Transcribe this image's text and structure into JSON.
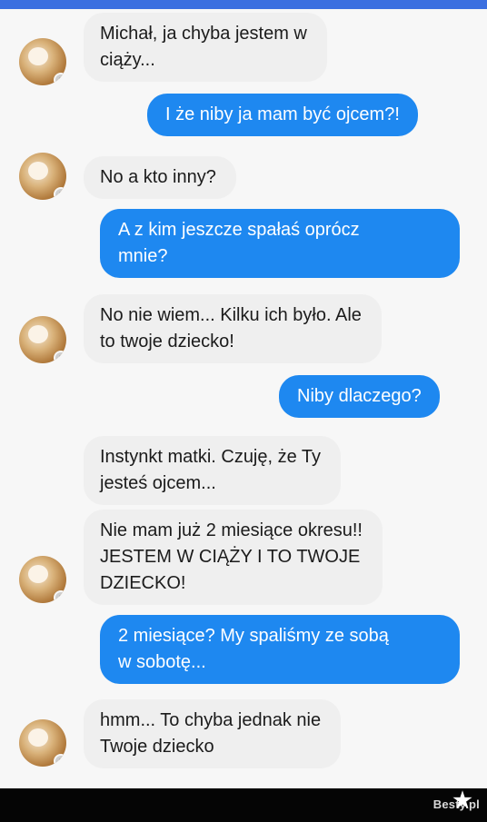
{
  "conversation": {
    "messages": [
      {
        "side": "incoming",
        "lines": [
          "Michał, ja chyba jestem w",
          "ciąży..."
        ]
      },
      {
        "side": "outgoing",
        "lines": [
          "I że niby ja mam być ojcem?!"
        ]
      },
      {
        "side": "incoming",
        "lines": [
          "No a kto inny?"
        ]
      },
      {
        "side": "outgoing",
        "lines": [
          "A z kim jeszcze spałaś oprócz",
          "mnie?"
        ]
      },
      {
        "side": "incoming",
        "lines": [
          "No nie wiem... Kilku ich było. Ale",
          "to twoje dziecko!"
        ]
      },
      {
        "side": "outgoing",
        "lines": [
          "Niby dlaczego?"
        ]
      },
      {
        "side": "incoming",
        "lines": [
          "Instynkt matki. Czuję, że Ty",
          "jesteś ojcem..."
        ]
      },
      {
        "side": "incoming",
        "lines": [
          "Nie mam już 2 miesiące okresu!!",
          "JESTEM W CIĄŻY I TO TWOJE",
          "DZIECKO!"
        ]
      },
      {
        "side": "outgoing",
        "lines": [
          "2 miesiące? My spaliśmy ze sobą",
          "w sobotę..."
        ]
      },
      {
        "side": "incoming",
        "lines": [
          "hmm... To chyba jednak nie",
          "Twoje dziecko"
        ]
      }
    ]
  },
  "watermark": {
    "text": "Besty.pl"
  },
  "colors": {
    "incoming_bubble": "#efefef",
    "outgoing_bubble": "#1e88f0",
    "top_bar": "#3b6fe0",
    "footer": "#050505"
  }
}
